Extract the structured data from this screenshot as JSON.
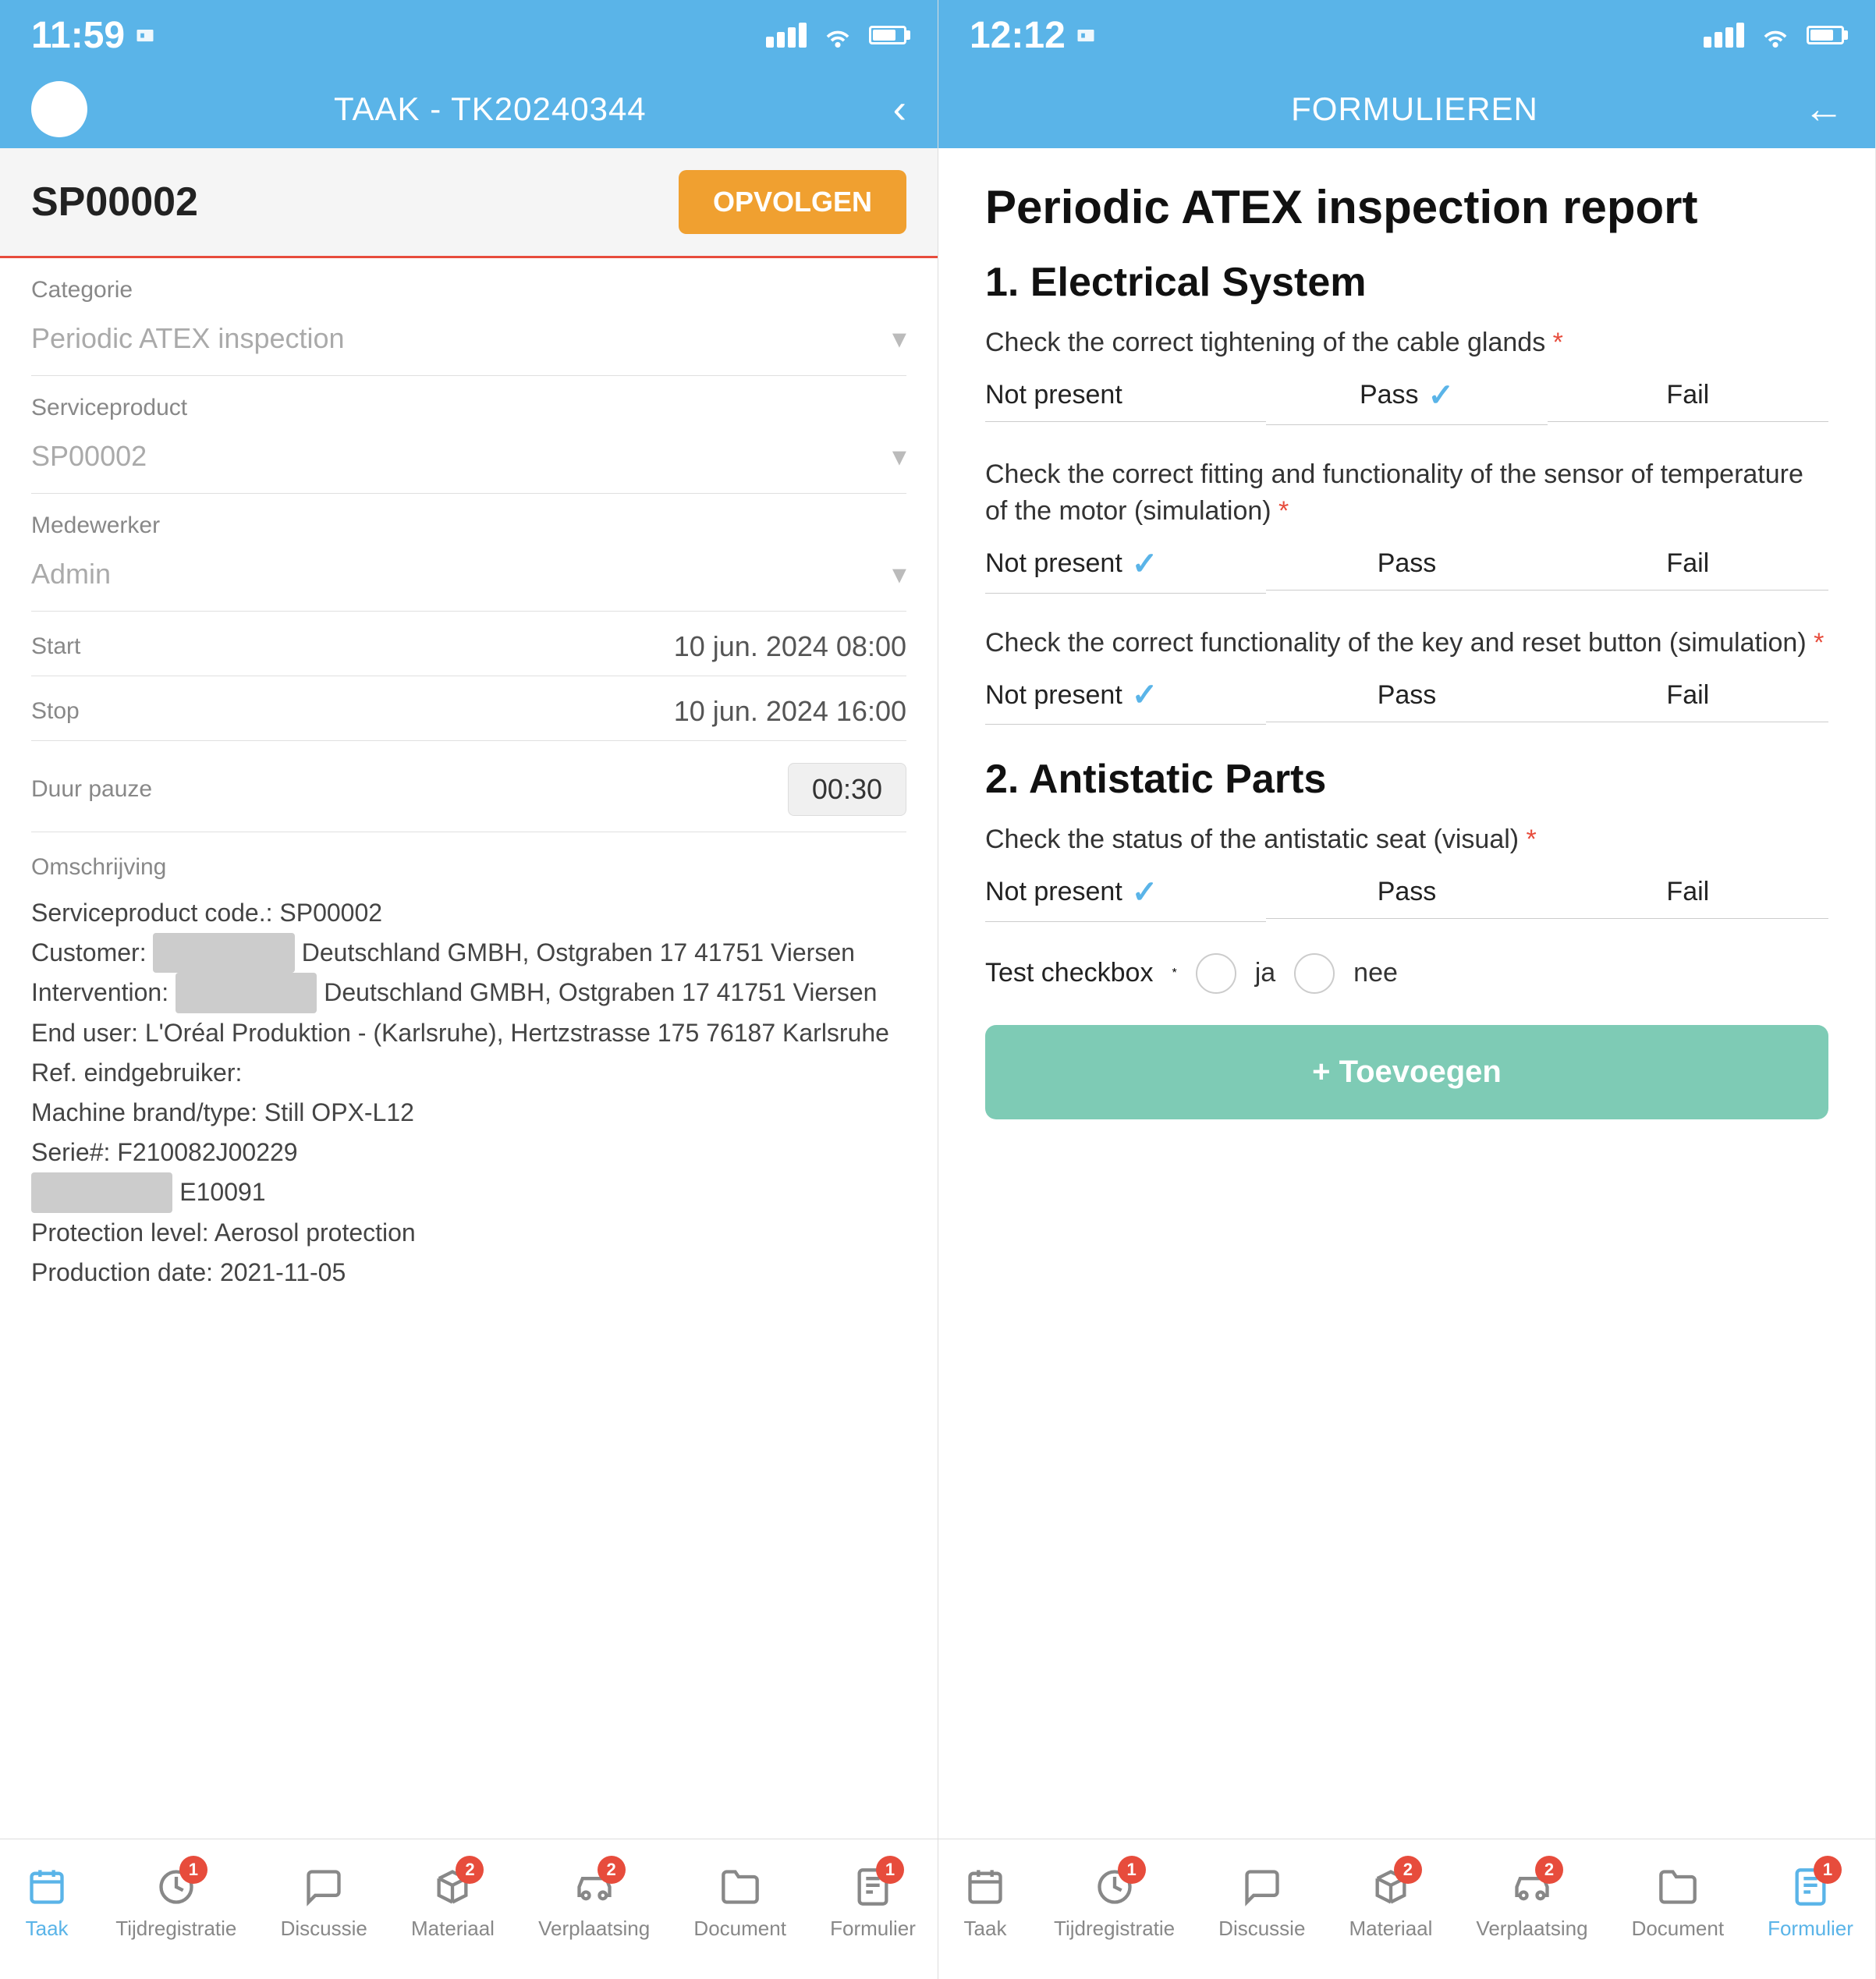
{
  "left_phone": {
    "status_bar": {
      "time": "11:59",
      "sim_icon": "sim"
    },
    "header": {
      "title": "TAAK - TK20240344",
      "back_label": "‹",
      "has_avatar": true
    },
    "sp_card": {
      "code": "SP00002",
      "button_label": "OPVOLGEN"
    },
    "fields": [
      {
        "label": "Categorie",
        "value": "Periodic ATEX inspection",
        "has_dropdown": true
      },
      {
        "label": "Serviceproduct",
        "value": "SP00002",
        "has_dropdown": true
      },
      {
        "label": "Medewerker",
        "value": "Admin",
        "has_dropdown": true
      }
    ],
    "start": {
      "label": "Start",
      "value": "10 jun. 2024 08:00"
    },
    "stop": {
      "label": "Stop",
      "value": "10 jun. 2024 16:00"
    },
    "duur_pauze": {
      "label": "Duur pauze",
      "value": "00:30"
    },
    "omschrijving": {
      "label": "Omschrijving",
      "lines": [
        "Serviceproduct code.: SP00002",
        "Customer: [BLURRED] Deutschland GMBH, Ostgraben 17 41751 Viersen",
        "Intervention: [BLURRED] Deutschland GMBH, Ostgraben 17 41751 Viersen",
        "End user: L'Oréal Produktion - (Karlsruhe), Hertzstrasse 175 76187 Karlsruhe",
        "Ref. eindgebruiker:",
        "Machine brand/type: Still OPX-L12",
        "Serie#: F210082J00229",
        "[BLURRED] E10091",
        "Protection level: Aerosol protection",
        "Production date: 2021-11-05"
      ]
    },
    "bottom_nav": [
      {
        "label": "Taak",
        "active": true,
        "badge": null,
        "icon": "calendar-icon"
      },
      {
        "label": "Tijdregistratie",
        "active": false,
        "badge": "1",
        "icon": "clock-icon"
      },
      {
        "label": "Discussie",
        "active": false,
        "badge": null,
        "icon": "chat-icon"
      },
      {
        "label": "Materiaal",
        "active": false,
        "badge": "2",
        "icon": "box-icon"
      },
      {
        "label": "Verplaatsing",
        "active": false,
        "badge": "2",
        "icon": "car-icon"
      },
      {
        "label": "Document",
        "active": false,
        "badge": null,
        "icon": "folder-icon"
      },
      {
        "label": "Formulier",
        "active": false,
        "badge": "1",
        "icon": "form-icon"
      }
    ]
  },
  "right_phone": {
    "status_bar": {
      "time": "12:12"
    },
    "header": {
      "title": "FORMULIEREN",
      "back_label": "←"
    },
    "form": {
      "main_title": "Periodic ATEX inspection report",
      "sections": [
        {
          "title": "1. Electrical System",
          "checks": [
            {
              "question": "Check the correct tightening of the cable glands",
              "required": true,
              "options": [
                "Not present",
                "Pass",
                "Fail"
              ],
              "selected": "Pass"
            },
            {
              "question": "Check the correct fitting and functionality of the sensor of temperature of the motor (simulation)",
              "required": true,
              "options": [
                "Not present",
                "Pass",
                "Fail"
              ],
              "selected": "Not present"
            },
            {
              "question": "Check the correct functionality of the key and reset button (simulation)",
              "required": true,
              "options": [
                "Not present",
                "Pass",
                "Fail"
              ],
              "selected": "Not present"
            }
          ]
        },
        {
          "title": "2. Antistatic Parts",
          "checks": [
            {
              "question": "Check the status of the antistatic seat (visual)",
              "required": true,
              "options": [
                "Not present",
                "Pass",
                "Fail"
              ],
              "selected": "Not present"
            }
          ],
          "checkbox_item": {
            "label": "Test checkbox",
            "required": true,
            "options": [
              {
                "label": "ja"
              },
              {
                "label": "nee"
              }
            ]
          }
        }
      ],
      "add_button_label": "+ Toevoegen"
    },
    "bottom_nav": [
      {
        "label": "Taak",
        "active": false,
        "badge": null,
        "icon": "calendar-icon"
      },
      {
        "label": "Tijdregistratie",
        "active": false,
        "badge": "1",
        "icon": "clock-icon"
      },
      {
        "label": "Discussie",
        "active": false,
        "badge": null,
        "icon": "chat-icon"
      },
      {
        "label": "Materiaal",
        "active": false,
        "badge": "2",
        "icon": "box-icon"
      },
      {
        "label": "Verplaatsing",
        "active": false,
        "badge": "2",
        "icon": "car-icon"
      },
      {
        "label": "Document",
        "active": false,
        "badge": null,
        "icon": "folder-icon"
      },
      {
        "label": "Formulier",
        "active": true,
        "badge": "1",
        "icon": "form-icon"
      }
    ]
  }
}
